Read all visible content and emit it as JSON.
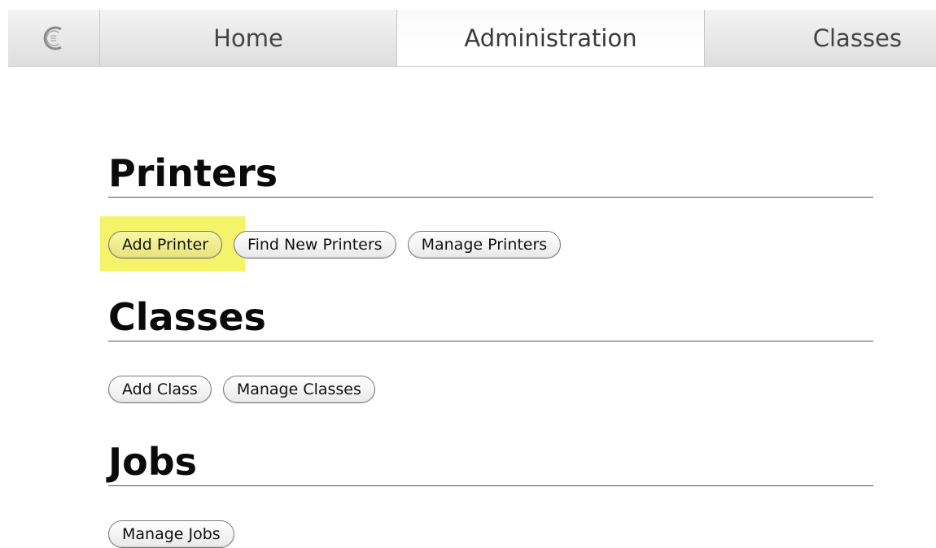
{
  "nav": {
    "logo_icon": "cups-logo-icon",
    "tabs": [
      {
        "label": "Home"
      },
      {
        "label": "Administration",
        "active": true
      },
      {
        "label": "Classes"
      }
    ]
  },
  "sections": {
    "printers": {
      "title": "Printers",
      "buttons": [
        "Add Printer",
        "Find New Printers",
        "Manage Printers"
      ],
      "highlighted_button": "Add Printer",
      "highlight_color": "#f4f36a"
    },
    "classes": {
      "title": "Classes",
      "buttons": [
        "Add Class",
        "Manage Classes"
      ]
    },
    "jobs": {
      "title": "Jobs",
      "buttons": [
        "Manage Jobs"
      ]
    }
  }
}
